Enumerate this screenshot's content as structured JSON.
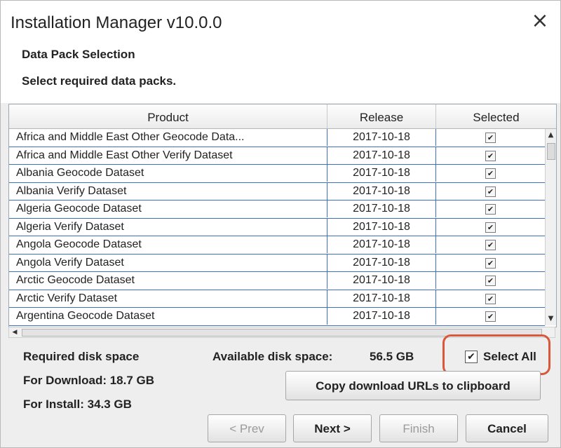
{
  "window": {
    "title": "Installation Manager v10.0.0",
    "close_glyph": "×"
  },
  "header": {
    "section_title": "Data Pack Selection",
    "description": "Select required data packs."
  },
  "table": {
    "columns": [
      "Product",
      "Release",
      "Selected"
    ],
    "rows": [
      {
        "product": "Africa and Middle East Other Geocode Data...",
        "release": "2017-10-18",
        "selected": true
      },
      {
        "product": "Africa and Middle East Other Verify Dataset",
        "release": "2017-10-18",
        "selected": true
      },
      {
        "product": "Albania Geocode Dataset",
        "release": "2017-10-18",
        "selected": true
      },
      {
        "product": "Albania Verify Dataset",
        "release": "2017-10-18",
        "selected": true
      },
      {
        "product": "Algeria Geocode Dataset",
        "release": "2017-10-18",
        "selected": true
      },
      {
        "product": "Algeria Verify Dataset",
        "release": "2017-10-18",
        "selected": true
      },
      {
        "product": "Angola Geocode Dataset",
        "release": "2017-10-18",
        "selected": true
      },
      {
        "product": "Angola Verify Dataset",
        "release": "2017-10-18",
        "selected": true
      },
      {
        "product": "Arctic Geocode Dataset",
        "release": "2017-10-18",
        "selected": true
      },
      {
        "product": "Arctic Verify Dataset",
        "release": "2017-10-18",
        "selected": true
      },
      {
        "product": "Argentina Geocode Dataset",
        "release": "2017-10-18",
        "selected": true
      }
    ],
    "check_glyph": "✔"
  },
  "scrollbar": {
    "up_glyph": "▲",
    "down_glyph": "▼",
    "left_glyph": "◀"
  },
  "disk": {
    "required_label": "Required disk space",
    "download_label": "For Download: 18.7 GB",
    "install_label": "For Install: 34.3 GB",
    "available_label": "Available disk space:",
    "available_value": "56.5 GB"
  },
  "select_all": {
    "label": "Select All",
    "checked": true,
    "glyph": "✔"
  },
  "buttons": {
    "copy": "Copy download URLs to clipboard",
    "prev": "< Prev",
    "next": "Next >",
    "finish": "Finish",
    "cancel": "Cancel"
  },
  "colors": {
    "highlight": "#d9573a",
    "grid_line": "#3d6fbf"
  }
}
